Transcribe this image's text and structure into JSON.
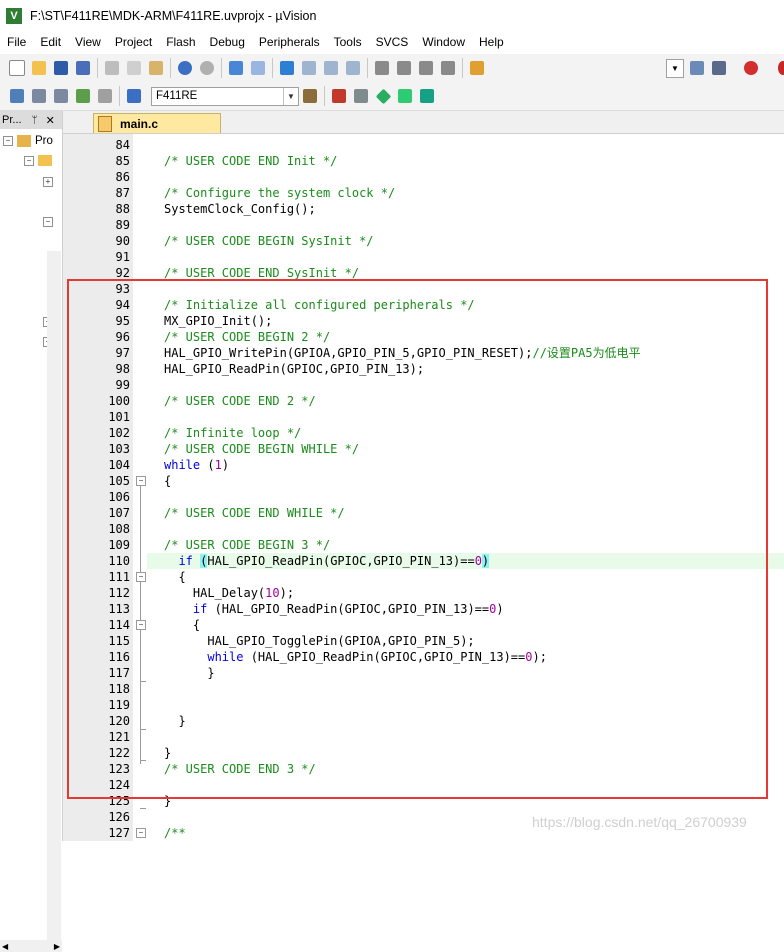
{
  "window": {
    "title": "F:\\ST\\F411RE\\MDK-ARM\\F411RE.uvprojx - µVision"
  },
  "menu": [
    "File",
    "Edit",
    "View",
    "Project",
    "Flash",
    "Debug",
    "Peripherals",
    "Tools",
    "SVCS",
    "Window",
    "Help"
  ],
  "toolbar": {
    "target": "F411RE"
  },
  "project_pane": {
    "title": "Pr...",
    "pin": "ᛘ",
    "close": "✕",
    "root_label": "Pro"
  },
  "editor": {
    "tab_label": "main.c",
    "lines": [
      {
        "n": "84",
        "t": ""
      },
      {
        "n": "85",
        "t": "/* USER CODE END Init */"
      },
      {
        "n": "86",
        "t": ""
      },
      {
        "n": "87",
        "t": "/* Configure the system clock */"
      },
      {
        "n": "88",
        "t": "SystemClock_Config();"
      },
      {
        "n": "89",
        "t": ""
      },
      {
        "n": "90",
        "t": "/* USER CODE BEGIN SysInit */"
      },
      {
        "n": "91",
        "t": ""
      },
      {
        "n": "92",
        "t": "/* USER CODE END SysInit */"
      },
      {
        "n": "93",
        "t": ""
      },
      {
        "n": "94",
        "t": "/* Initialize all configured peripherals */"
      },
      {
        "n": "95",
        "t": "MX_GPIO_Init();"
      },
      {
        "n": "96",
        "t": "/* USER CODE BEGIN 2 */"
      },
      {
        "n": "97",
        "t": "HAL_GPIO_WritePin(GPIOA,GPIO_PIN_5,GPIO_PIN_RESET);//设置PA5为低电平"
      },
      {
        "n": "98",
        "t": "HAL_GPIO_ReadPin(GPIOC,GPIO_PIN_13);"
      },
      {
        "n": "99",
        "t": ""
      },
      {
        "n": "100",
        "t": "/* USER CODE END 2 */"
      },
      {
        "n": "101",
        "t": ""
      },
      {
        "n": "102",
        "t": "/* Infinite loop */"
      },
      {
        "n": "103",
        "t": "/* USER CODE BEGIN WHILE */"
      },
      {
        "n": "104",
        "t": "while (1)"
      },
      {
        "n": "105",
        "t": "{"
      },
      {
        "n": "106",
        "t": ""
      },
      {
        "n": "107",
        "t": "/* USER CODE END WHILE */"
      },
      {
        "n": "108",
        "t": ""
      },
      {
        "n": "109",
        "t": "/* USER CODE BEGIN 3 */"
      },
      {
        "n": "110",
        "t": "  if (HAL_GPIO_ReadPin(GPIOC,GPIO_PIN_13)==0)"
      },
      {
        "n": "111",
        "t": "  {"
      },
      {
        "n": "112",
        "t": "    HAL_Delay(10);"
      },
      {
        "n": "113",
        "t": "    if (HAL_GPIO_ReadPin(GPIOC,GPIO_PIN_13)==0)"
      },
      {
        "n": "114",
        "t": "    {"
      },
      {
        "n": "115",
        "t": "      HAL_GPIO_TogglePin(GPIOA,GPIO_PIN_5);"
      },
      {
        "n": "116",
        "t": "      while (HAL_GPIO_ReadPin(GPIOC,GPIO_PIN_13)==0);"
      },
      {
        "n": "117",
        "t": "      }"
      },
      {
        "n": "118",
        "t": ""
      },
      {
        "n": "119",
        "t": ""
      },
      {
        "n": "120",
        "t": "  }"
      },
      {
        "n": "121",
        "t": ""
      },
      {
        "n": "122",
        "t": "}"
      },
      {
        "n": "123",
        "t": "/* USER CODE END 3 */"
      },
      {
        "n": "124",
        "t": ""
      },
      {
        "n": "125",
        "t": "}"
      },
      {
        "n": "126",
        "t": ""
      },
      {
        "n": "127",
        "t": "/**"
      }
    ]
  },
  "watermark": "https://blog.csdn.net/qq_26700939",
  "colors": {
    "annotation_box": "#e53935",
    "comment": "#1a8c1a",
    "keyword": "#0000e0",
    "number": "#a000a0",
    "current_line": "#e8fbe8"
  }
}
